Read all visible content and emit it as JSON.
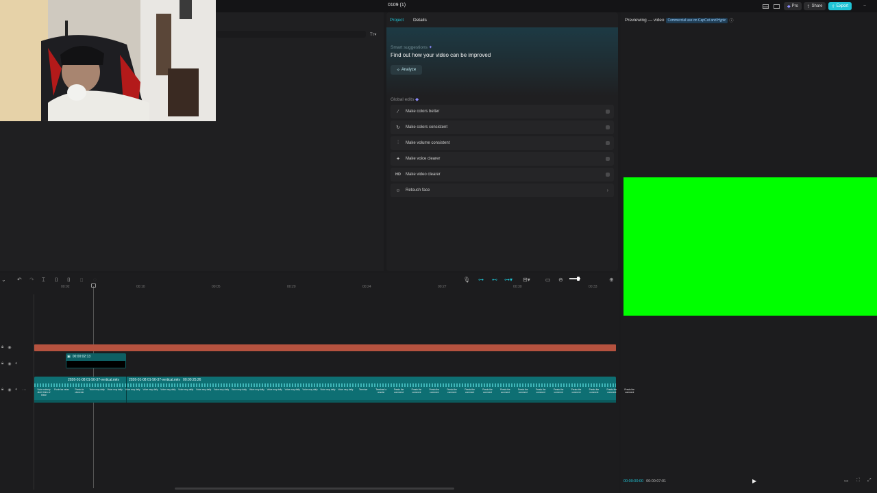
{
  "topbar": {
    "title": "0109 (1)",
    "pro_label": "Pro",
    "share_label": "Share",
    "export_label": "Export",
    "minimize_label": "–"
  },
  "colors": {
    "accent": "#20c5d6",
    "timeline_red": "#b5523f",
    "clip_teal": "#0e6f73",
    "preview_green": "#00ff00"
  },
  "mid_panel": {
    "tabs": [
      "Project",
      "Details"
    ],
    "smart_suggestions_label": "Smart suggestions",
    "smart_headline": "Find out how your video can be improved",
    "analyze_label": "Analyze",
    "global_edits_label": "Global edits",
    "edits": [
      {
        "icon": "magic-wand-icon",
        "label": "Make colors better"
      },
      {
        "icon": "color-sync-icon",
        "label": "Make colors consistent"
      },
      {
        "icon": "volume-sliders-icon",
        "label": "Make volume consistent"
      },
      {
        "icon": "voice-sparkle-icon",
        "label": "Make voice clearer"
      },
      {
        "icon": "hd-icon",
        "label": "Make video clearer"
      },
      {
        "icon": "face-retouch-icon",
        "label": "Retouch face"
      }
    ]
  },
  "preview": {
    "label": "Previewing — video",
    "commercial_badge": "Commercial use on CapCut and Hypic",
    "current_time": "00:00:00:00",
    "total_time": "00:00:07:01"
  },
  "timeline": {
    "ruler": [
      "00:02",
      "00:10",
      "00:05",
      "00:20",
      "00:24",
      "00:27",
      "00:30",
      "00:33"
    ],
    "small_clip_time": "00:00:02:13",
    "clip1_label": "2026-01-08 01-50-37-vertical.mkv",
    "clip2_label": "2026-01-08 01-50-37-vertical.mkv",
    "clip2_time": "00:00:25:26",
    "thumb_texts": [
      "Voice nobody didn't think of these",
      "Ponle las velas",
      "Presto la clemente",
      "Voice muy daily",
      "Voice muy daily",
      "Voice muy daily",
      "Voice muy daily",
      "Voice muy daily",
      "Voice muy daily",
      "Voice muy daily",
      "Voice muy daily",
      "Voice muy daily",
      "Voice muy daily",
      "Voice muy daily",
      "Voice muy daily",
      "Voice muy daily",
      "Voice muy daily",
      "Voice muy daily",
      "Terminar",
      "Terminar la oración",
      "Presto the commend",
      "Presto the comment",
      "Presto the comment",
      "Presto the comment",
      "Presto the comment",
      "Presto the comment",
      "Presto the comment",
      "Presto the comment",
      "Presto the comment",
      "Presto the comment",
      "Presto the comment",
      "Presto the comment",
      "Presto the comment",
      "Presto the comment"
    ]
  }
}
